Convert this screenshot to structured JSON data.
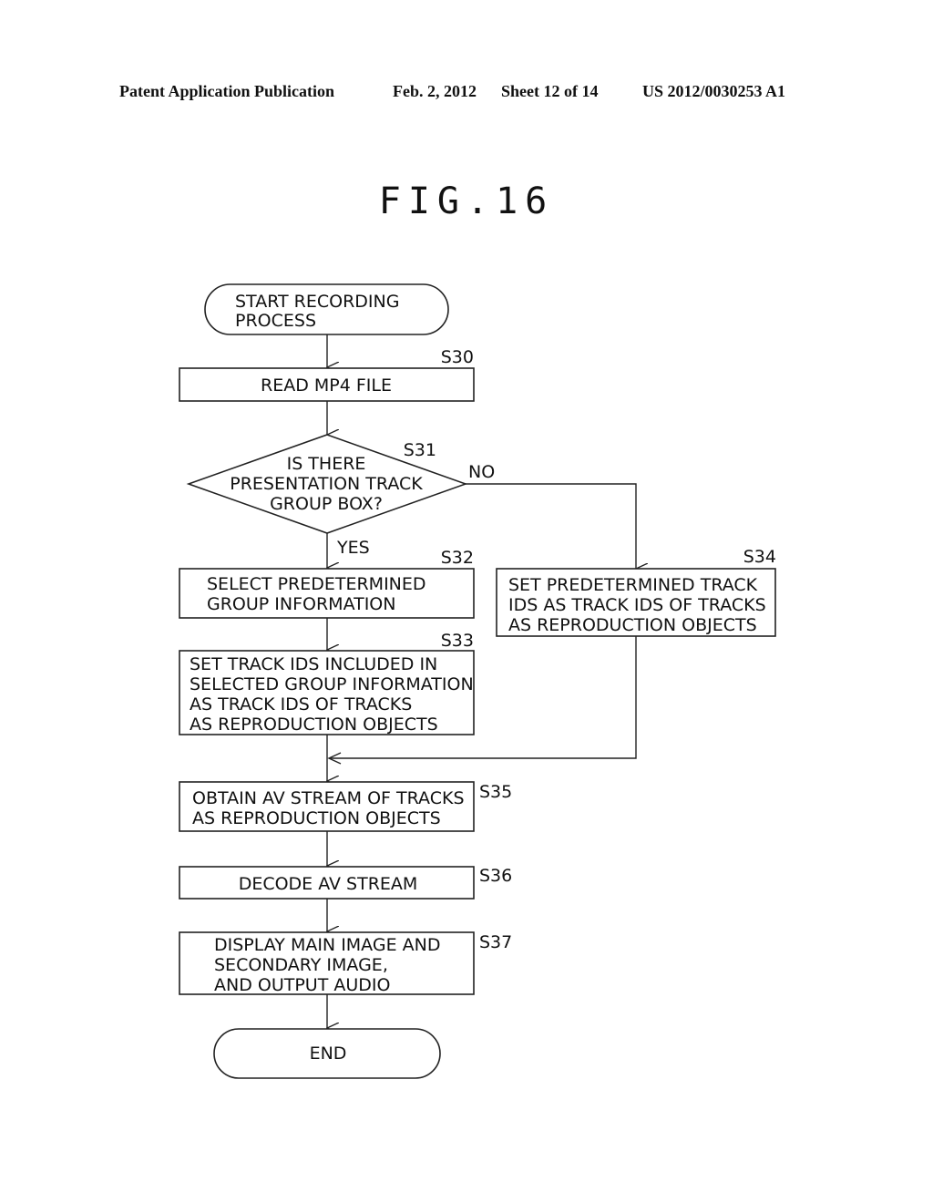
{
  "header": {
    "publication": "Patent Application Publication",
    "date": "Feb. 2, 2012",
    "sheet": "Sheet 12 of 14",
    "number": "US 2012/0030253 A1"
  },
  "figure": {
    "title": "FIG.16"
  },
  "flowchart": {
    "start": {
      "lines": [
        "START RECORDING",
        "PROCESS"
      ]
    },
    "steps": {
      "s30": {
        "id": "S30",
        "lines": [
          "READ MP4 FILE"
        ]
      },
      "s31": {
        "id": "S31",
        "lines": [
          "IS THERE",
          "PRESENTATION TRACK",
          "GROUP BOX?"
        ],
        "yes": "YES",
        "no": "NO"
      },
      "s32": {
        "id": "S32",
        "lines": [
          "SELECT PREDETERMINED",
          "GROUP INFORMATION"
        ]
      },
      "s33": {
        "id": "S33",
        "lines": [
          "SET TRACK IDS INCLUDED IN",
          "SELECTED GROUP INFORMATION",
          "AS TRACK IDS OF TRACKS",
          "AS REPRODUCTION OBJECTS"
        ]
      },
      "s34": {
        "id": "S34",
        "lines": [
          "SET PREDETERMINED TRACK",
          "IDS AS TRACK IDS OF TRACKS",
          "AS REPRODUCTION OBJECTS"
        ]
      },
      "s35": {
        "id": "S35",
        "lines": [
          "OBTAIN AV STREAM OF TRACKS",
          "AS REPRODUCTION OBJECTS"
        ]
      },
      "s36": {
        "id": "S36",
        "lines": [
          "DECODE AV STREAM"
        ]
      },
      "s37": {
        "id": "S37",
        "lines": [
          "DISPLAY MAIN IMAGE AND",
          "SECONDARY IMAGE,",
          "AND OUTPUT AUDIO"
        ]
      }
    },
    "end": {
      "lines": [
        "END"
      ]
    }
  }
}
